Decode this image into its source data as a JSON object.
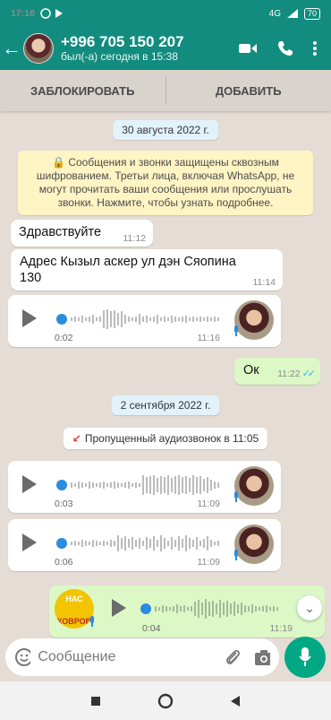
{
  "status_bar": {
    "time": "17:18",
    "network": "4G",
    "battery": "70"
  },
  "header": {
    "contact": "+996 705 150 207",
    "last_seen": "был(-а) сегодня в 15:38"
  },
  "actions": {
    "block": "ЗАБЛОКИРОВАТЬ",
    "add": "ДОБАВИТЬ"
  },
  "chat": {
    "date1": "30 августа 2022 г.",
    "encryption_notice": "🔒 Сообщения и звонки защищены сквозным шифрованием. Третьи лица, включая WhatsApp, не могут прочитать ваши сообщения или прослушать звонки. Нажмите, чтобы узнать подробнее.",
    "msg1": {
      "text": "Здравствуйте",
      "time": "11:12"
    },
    "msg2": {
      "text": "Адрес  Кызыл  аскер ул дэн Сяопина 130",
      "time": "11:14"
    },
    "voice1": {
      "duration": "0:02",
      "time": "11:16"
    },
    "msg3": {
      "text": "Ок",
      "time": "11:22"
    },
    "date2": "2 сентября 2022 г.",
    "missed_call": "Пропущенный аудиозвонок в 11:05",
    "voice2": {
      "duration": "0:03",
      "time": "11:09"
    },
    "voice3": {
      "duration": "0:06",
      "time": "11:09"
    },
    "voice4": {
      "duration": "0:04",
      "time": "11:19",
      "avatar_text_top": "НАС",
      "avatar_text_bottom": "КОВРОВ"
    }
  },
  "composer": {
    "placeholder": "Сообщение"
  },
  "colors": {
    "header": "#128c7e",
    "outgoing": "#dcf8c6",
    "accent": "#00a884",
    "read_ticks": "#34b7f1"
  }
}
